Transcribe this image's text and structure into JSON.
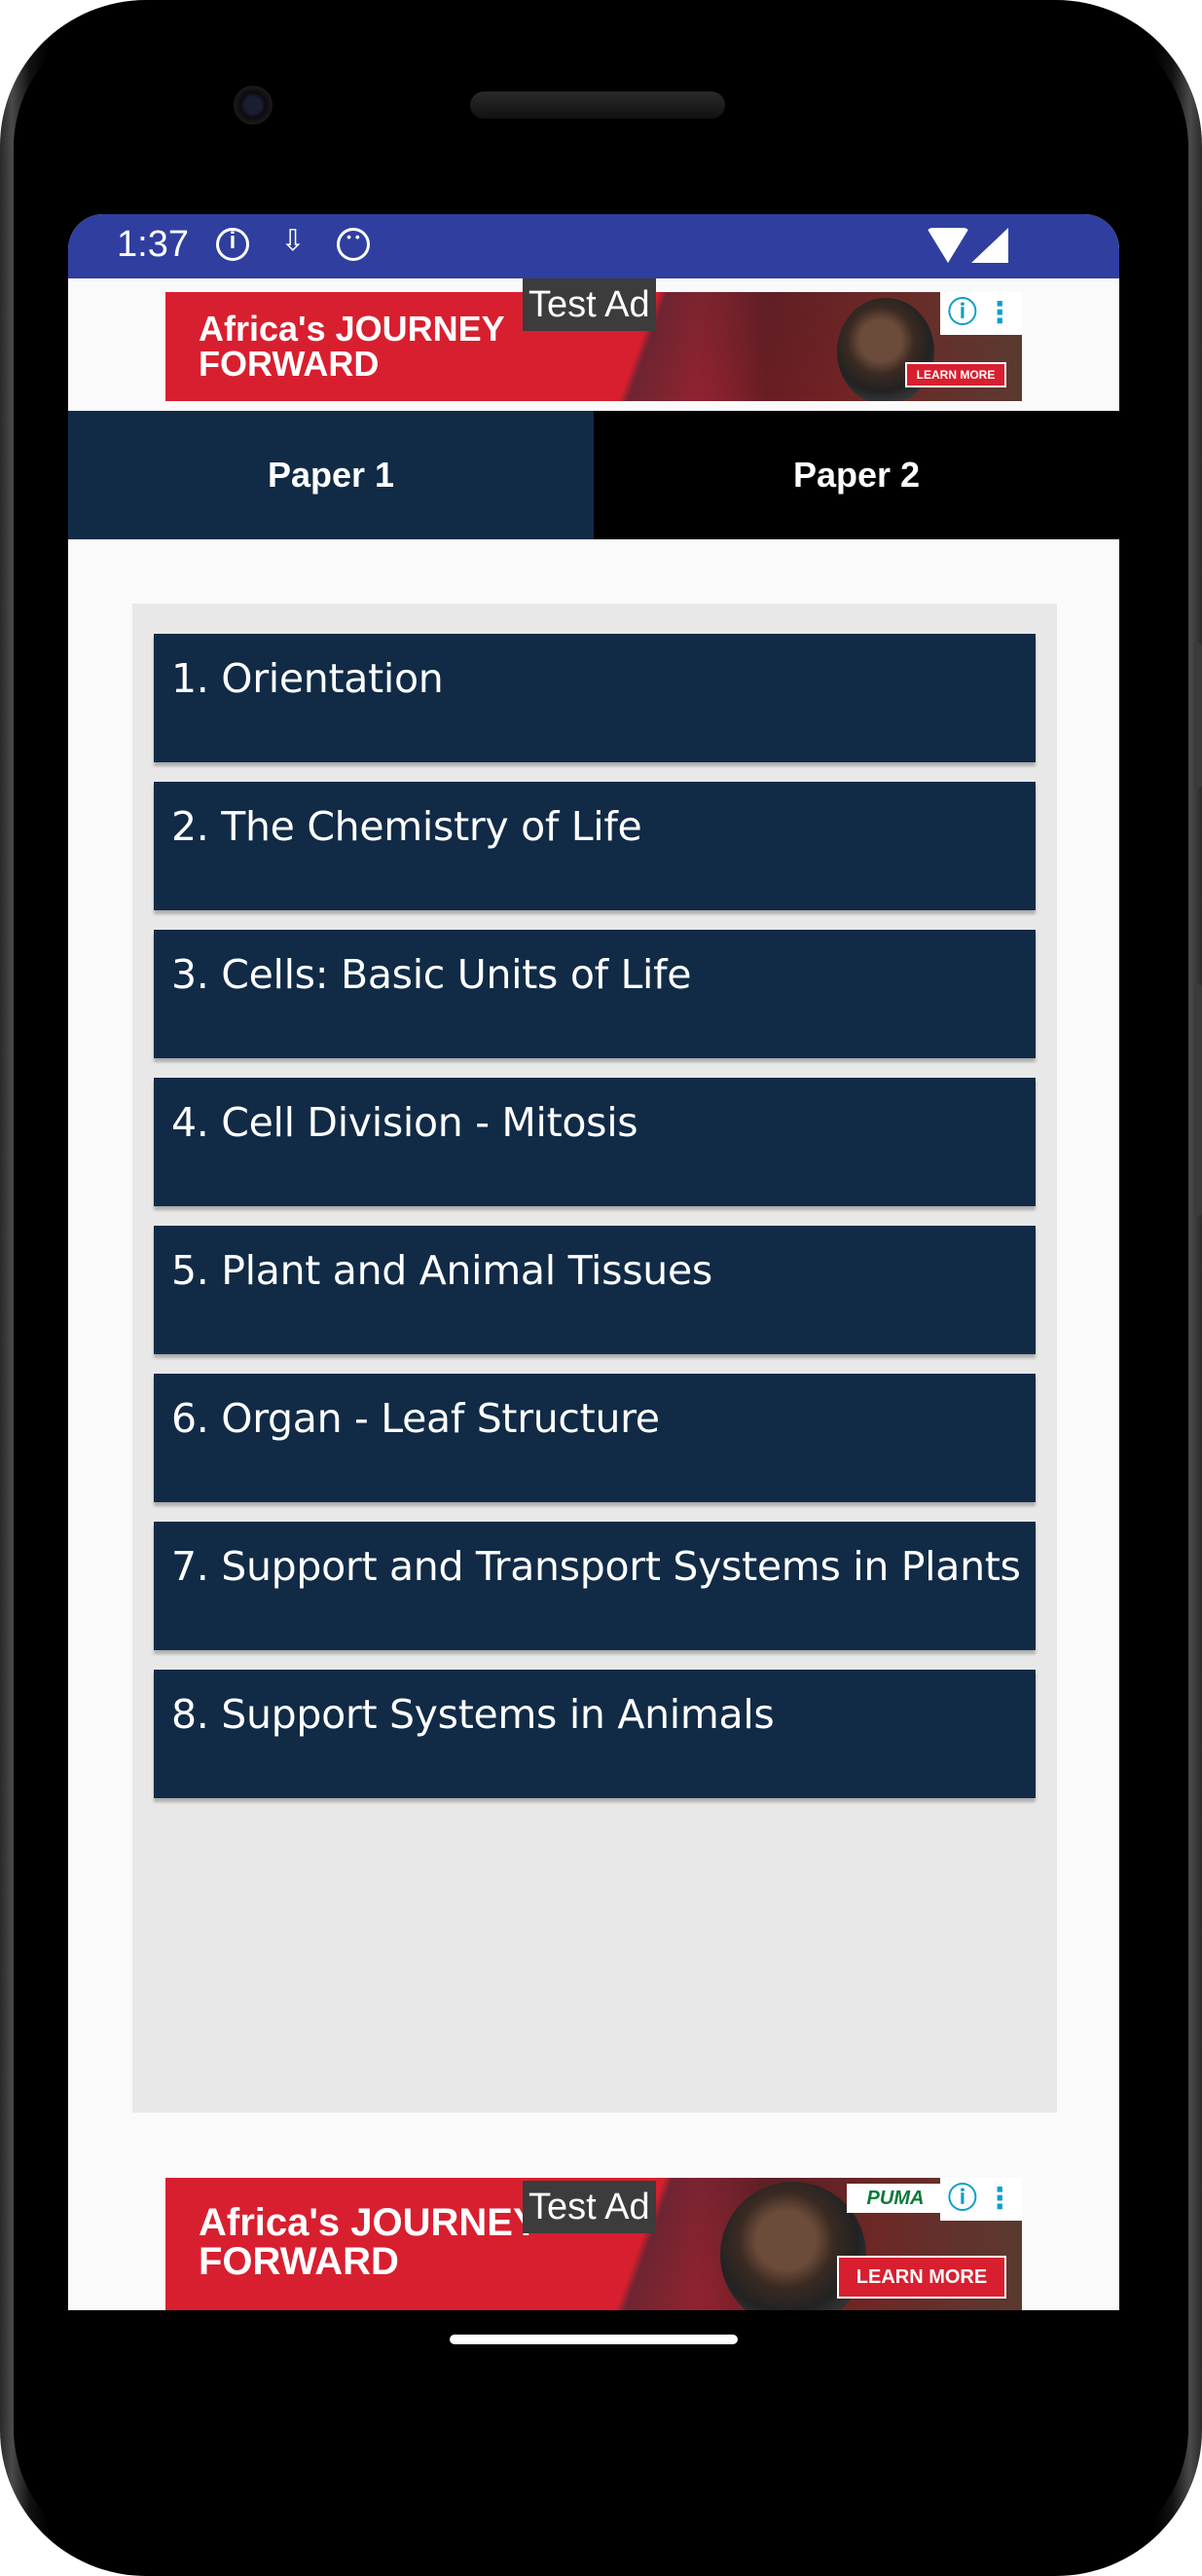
{
  "status_bar": {
    "time": "1:37",
    "icons": [
      "info-icon",
      "download-icon",
      "face-icon",
      "wifi-icon",
      "signal-icon"
    ]
  },
  "top_ad": {
    "headline_line1": "Africa's JOURNEY",
    "headline_line2": "FORWARD",
    "test_label": "Test Ad",
    "cta": "LEARN MORE",
    "info_symbol": "ⓘ ⋮"
  },
  "tabs": [
    {
      "label": "Paper 1",
      "active": true
    },
    {
      "label": "Paper 2",
      "active": false
    }
  ],
  "topics": [
    "1. Orientation",
    "2. The Chemistry of Life",
    "3. Cells: Basic Units of Life",
    "4. Cell Division - Mitosis",
    "5. Plant and Animal Tissues",
    "6. Organ - Leaf Structure",
    "7. Support and Transport Systems in Plants",
    "8. Support Systems in Animals"
  ],
  "bottom_ad": {
    "headline_line1": "Africa's JOURNEY",
    "headline_line2": "FORWARD",
    "test_label": "Test Ad",
    "cta": "LEARN MORE",
    "logo": "PUMA",
    "info_symbol": "ⓘ ⋮"
  },
  "colors": {
    "status_bar": "#303f9f",
    "navy": "#112b47",
    "ad_red": "#d81f2f",
    "panel": "#e8e8e8"
  }
}
